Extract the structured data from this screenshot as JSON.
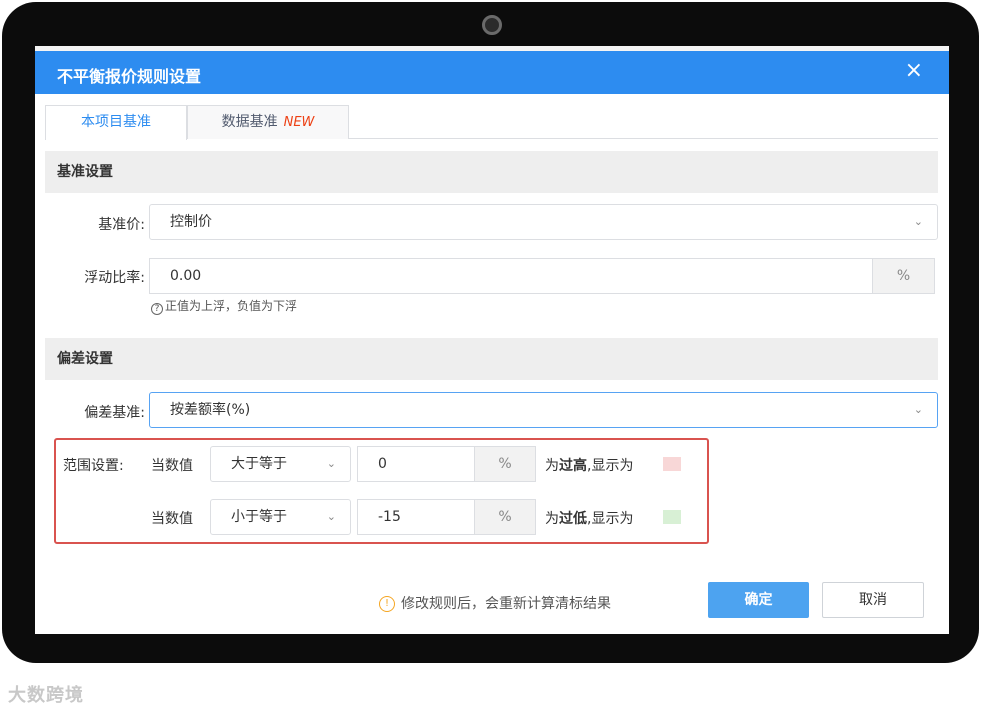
{
  "dialog": {
    "title": "不平衡报价规则设置",
    "close_icon": "×"
  },
  "tabs": [
    {
      "label": "本项目基准",
      "active": true
    },
    {
      "label": "数据基准",
      "badge": "NEW",
      "active": false
    }
  ],
  "benchmark_section": {
    "header": "基准设置",
    "price_label": "基准价:",
    "price_value": "控制价",
    "float_label": "浮动比率:",
    "float_value": "0.00",
    "float_unit": "%",
    "hint": "正值为上浮，负值为下浮"
  },
  "deviation_section": {
    "header": "偏差设置",
    "basis_label": "偏差基准:",
    "basis_value": "按差额率(%)"
  },
  "range": {
    "label": "范围设置:",
    "rows": [
      {
        "prefix": "当数值",
        "operator": "大于等于",
        "value": "0",
        "unit": "%",
        "text_pre": "为",
        "text_bold": "过高",
        "text_post": ",显示为",
        "swatch_color": "#f8d7d7"
      },
      {
        "prefix": "当数值",
        "operator": "小于等于",
        "value": "-15",
        "unit": "%",
        "text_pre": "为",
        "text_bold": "过低",
        "text_post": ",显示为",
        "swatch_color": "#d8f0d5"
      }
    ]
  },
  "footer": {
    "note": "修改规则后，会重新计算清标结果",
    "confirm_label": "确定",
    "cancel_label": "取消"
  },
  "watermark": "大数跨境",
  "colors": {
    "accent": "#2d8cf0",
    "highlight_border": "#d9534f",
    "warning": "#f5a623"
  }
}
